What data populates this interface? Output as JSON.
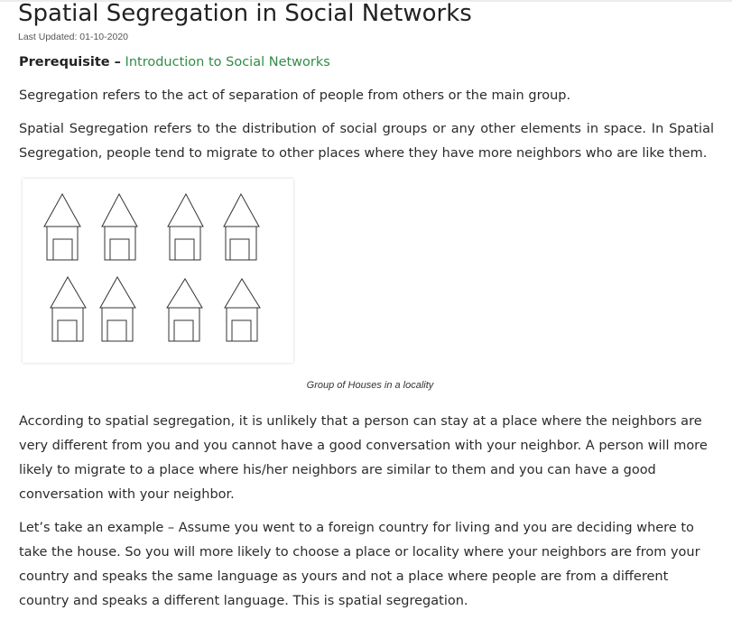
{
  "article": {
    "title": "Spatial Segregation in Social Networks",
    "last_updated": "Last Updated: 01-10-2020",
    "prerequisite_label": "Prerequisite –",
    "prerequisite_link": "Introduction to Social Networks",
    "paragraphs": [
      "Segregation refers to the act of separation of people from others or the main group.",
      "Spatial Segregation refers to the distribution of social groups or any other elements in space. In Spatial Segregation, people tend to migrate to other places where they have more neighbors who are like them.",
      "According to spatial segregation, it is unlikely that a person can stay at a place where the neighbors are very different from you and you cannot have a good conversation with your neighbor. A person will more likely to migrate to a place where his/her neighbors are similar to them and you can have a good conversation with your neighbor.",
      "Let’s take an example – Assume you went to a foreign country for living and you are deciding where to take the house. So you will more likely to choose a place or locality where your neighbors are from your country and speaks the same language as yours and not a place where people are from a different country and speaks a different language. This is spatial segregation."
    ],
    "figure_caption": "Group  of Houses in a locality"
  },
  "colors": {
    "link": "#2f8d46",
    "text": "#222222",
    "house_stroke": "#333333"
  }
}
